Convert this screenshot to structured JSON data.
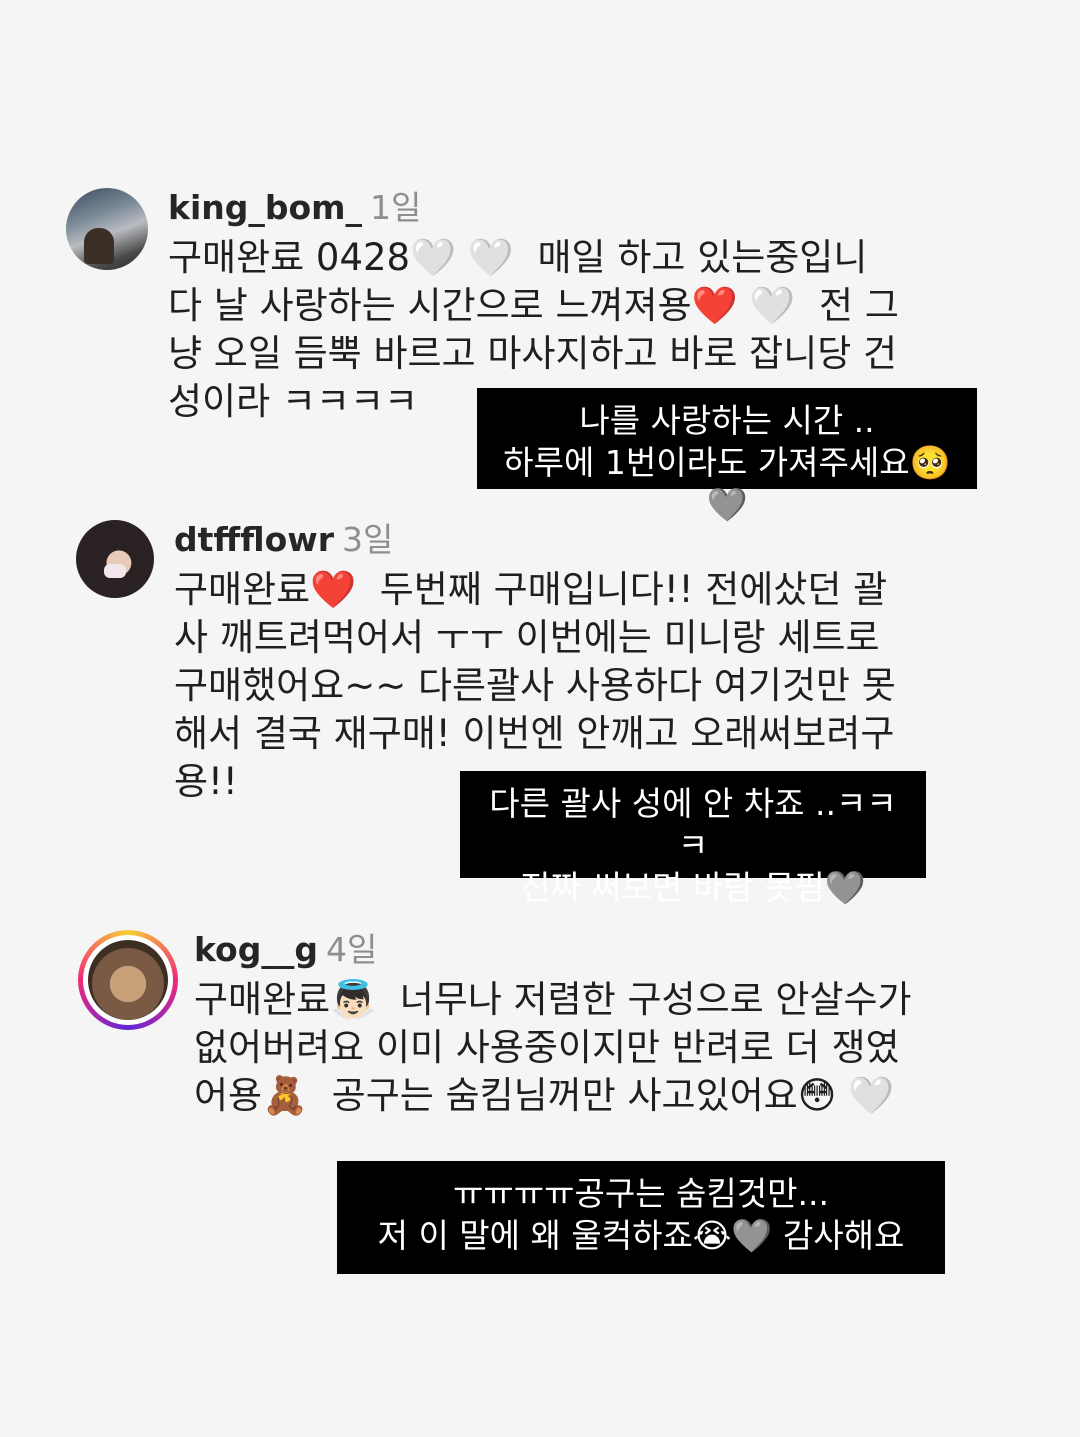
{
  "comments": [
    {
      "username": "king_bom_",
      "time": "1일",
      "text": "구매완료 0428🤍 🤍  매일 하고 있는중입니\n다 날 사랑하는 시간으로 느껴져용❤️ 🤍  전 그\n냥 오일 듬뿍 바르고 마사지하고 바로 잡니당 건\n성이라 ㅋㅋㅋㅋ",
      "reply": "나를 사랑하는 시간 ..\n하루에 1번이라도 가져주세요🥺🩶"
    },
    {
      "username": "dtffflowr",
      "time": "3일",
      "text": "구매완료❤️  두번째 구매입니다!! 전에샀던 괄\n사 깨트려먹어서 ㅜㅜ 이번에는 미니랑 세트로\n구매했어요~~ 다른괄사 사용하다 여기것만 못\n해서 결국 재구매! 이번엔 안깨고 오래써보려구\n용!!",
      "reply": "다른 괄사 성에 안 차죠 ..ㅋㅋㅋ\n진짜 써보면 바람 못핌🩶"
    },
    {
      "username": "kog__g",
      "time": "4일",
      "text": "구매완료👼🏻  너무나 저렴한 구성으로 안살수가\n없어버려요 이미 사용중이지만 반려로 더 쟁였\n어용🧸  공구는 숨킴님꺼만 사고있어요😳 🤍",
      "reply": "ㅠㅠㅠㅠ공구는 숨킴것만...\n저 이 말에 왜 울컥하죠😭🩶 감사해요"
    }
  ]
}
